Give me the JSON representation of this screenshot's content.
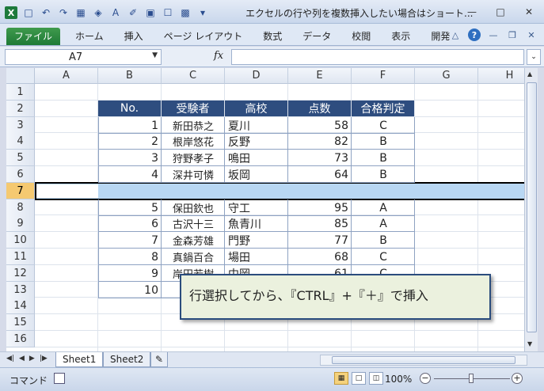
{
  "window": {
    "title": "エクセルの行や列を複数挿入したい場合はショート...",
    "app_icon": "X"
  },
  "ribbon": {
    "tabs": [
      "ファイル",
      "ホーム",
      "挿入",
      "ページ レイアウト",
      "数式",
      "データ",
      "校閲",
      "表示",
      "開発"
    ]
  },
  "formula_bar": {
    "name_box": "A7",
    "fx_label": "fx",
    "formula": ""
  },
  "grid": {
    "columns": [
      "A",
      "B",
      "C",
      "D",
      "E",
      "F",
      "G",
      "H"
    ],
    "rows": [
      "1",
      "2",
      "3",
      "4",
      "5",
      "6",
      "7",
      "8",
      "9",
      "10",
      "11",
      "12",
      "13",
      "14",
      "15",
      "16"
    ],
    "selected_row": "7"
  },
  "table": {
    "headers": [
      "No.",
      "受験者",
      "高校",
      "点数",
      "合格判定"
    ],
    "rows": [
      [
        "1",
        "新田恭之",
        "夏川",
        "58",
        "C"
      ],
      [
        "2",
        "根岸悠花",
        "反野",
        "82",
        "B"
      ],
      [
        "3",
        "狩野孝子",
        "鳴田",
        "73",
        "B"
      ],
      [
        "4",
        "深井可憐",
        "坂岡",
        "64",
        "B"
      ],
      [
        "",
        "",
        "",
        "",
        ""
      ],
      [
        "5",
        "保田欽也",
        "守工",
        "95",
        "A"
      ],
      [
        "6",
        "古沢十三",
        "魚青川",
        "85",
        "A"
      ],
      [
        "7",
        "金森芳雄",
        "門野",
        "77",
        "B"
      ],
      [
        "8",
        "真鍋百合",
        "場田",
        "68",
        "C"
      ],
      [
        "9",
        "岸田若樹",
        "中岡",
        "61",
        "C"
      ],
      [
        "10",
        "清",
        "",
        "",
        ""
      ]
    ]
  },
  "callout": {
    "text": "行選択してから、『CTRL』+『＋』で挿入"
  },
  "sheets": [
    "Sheet1",
    "Sheet2"
  ],
  "status": {
    "mode": "コマンド",
    "zoom": "100%"
  },
  "colors": {
    "header_fill": "#2e4d7f",
    "selection": "#b8d7f3",
    "callout_fill": "#ebf1de",
    "file_tab": "#1f7a36"
  }
}
